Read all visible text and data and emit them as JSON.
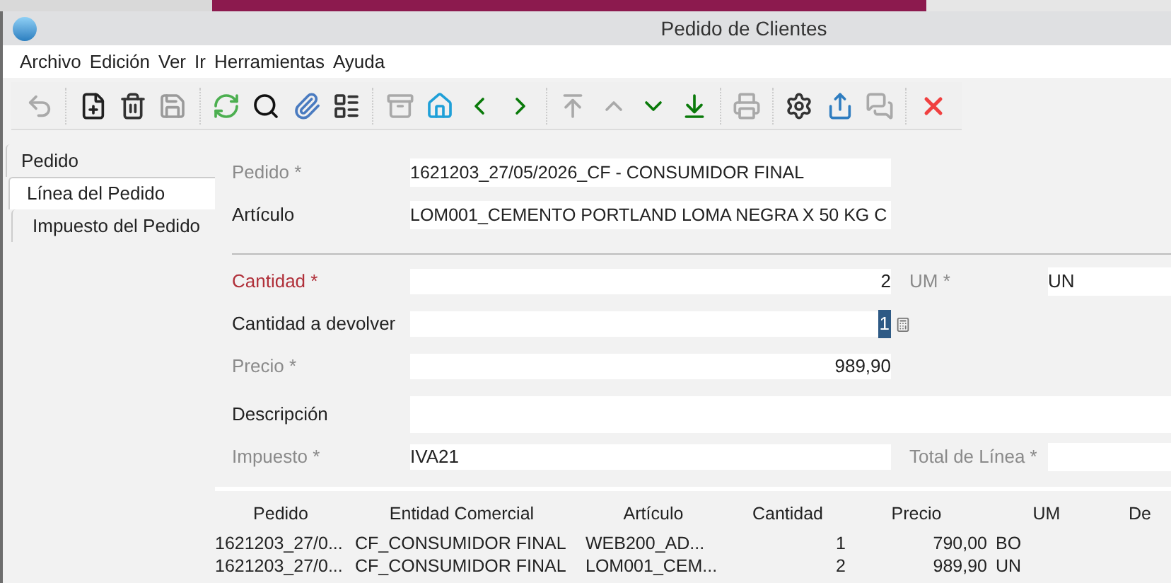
{
  "window": {
    "title": "Pedido de Clientes"
  },
  "menu": [
    {
      "label": "Archivo"
    },
    {
      "label": "Edición"
    },
    {
      "label": "Ver"
    },
    {
      "label": "Ir"
    },
    {
      "label": "Herramientas"
    },
    {
      "label": "Ayuda"
    }
  ],
  "toolbar": [
    {
      "kind": "undo",
      "disabled": true
    },
    {
      "kind": "sep"
    },
    {
      "kind": "new",
      "disabled": false
    },
    {
      "kind": "delete",
      "disabled": false
    },
    {
      "kind": "save",
      "disabled": true
    },
    {
      "kind": "sep"
    },
    {
      "kind": "refresh",
      "disabled": false
    },
    {
      "kind": "find",
      "disabled": false
    },
    {
      "kind": "attach",
      "disabled": false
    },
    {
      "kind": "grid",
      "disabled": false
    },
    {
      "kind": "sep"
    },
    {
      "kind": "archive",
      "disabled": true
    },
    {
      "kind": "home",
      "disabled": false
    },
    {
      "kind": "prev",
      "disabled": false
    },
    {
      "kind": "next",
      "disabled": false
    },
    {
      "kind": "sep"
    },
    {
      "kind": "first",
      "disabled": true
    },
    {
      "kind": "up",
      "disabled": true
    },
    {
      "kind": "down",
      "disabled": false
    },
    {
      "kind": "last",
      "disabled": false
    },
    {
      "kind": "sep"
    },
    {
      "kind": "print",
      "disabled": true
    },
    {
      "kind": "sep"
    },
    {
      "kind": "process",
      "disabled": false
    },
    {
      "kind": "export",
      "disabled": false
    },
    {
      "kind": "chat",
      "disabled": true
    },
    {
      "kind": "sep"
    },
    {
      "kind": "close",
      "disabled": false
    }
  ],
  "tabs": [
    {
      "label": "Pedido",
      "selected": false,
      "children": [
        {
          "label": "Línea del Pedido",
          "selected": true,
          "children": [
            {
              "label": "Impuesto del Pedido",
              "selected": false
            }
          ]
        }
      ]
    }
  ],
  "form": {
    "header_fields": [
      {
        "label": "Pedido *",
        "disabled": true,
        "value": "1621203_27/05/2026_CF - CONSUMIDOR FINAL"
      },
      {
        "label": "Artículo",
        "disabled": false,
        "value": "LOM001_CEMENTO PORTLAND LOMA NEGRA X 50 KG C"
      }
    ],
    "rows": [
      {
        "kind": "pair",
        "label": "Cantidad *",
        "disabled": false,
        "error": true,
        "value": "2",
        "numeric": true,
        "side_label": "UM *",
        "side_disabled": true,
        "side_value": "UN"
      },
      {
        "kind": "calc",
        "label": "Cantidad a devolver",
        "disabled": false,
        "error": false,
        "value": "1",
        "numeric": true,
        "selected": true
      },
      {
        "kind": "single",
        "label": "Precio *",
        "disabled": true,
        "error": false,
        "value": "989,90",
        "numeric": true
      },
      {
        "kind": "wide",
        "label": "Descripción",
        "disabled": false,
        "error": false
      },
      {
        "kind": "pair",
        "label": "Impuesto *",
        "disabled": true,
        "error": false,
        "value": "IVA21",
        "numeric": false,
        "side_label": "Total de Línea *",
        "side_disabled": true
      }
    ]
  },
  "table": {
    "columns": [
      "Pedido",
      "Entidad Comercial",
      "Artículo",
      "Cantidad",
      "Precio",
      "UM",
      "De"
    ],
    "rows": [
      [
        "1621203_27/0...",
        "CF_CONSUMIDOR FINAL",
        "WEB200_AD...",
        "1",
        "790,00",
        "BO"
      ],
      [
        "1621203_27/0...",
        "CF_CONSUMIDOR FINAL",
        "LOM001_CEM...",
        "2",
        "989,90",
        "UN"
      ]
    ]
  }
}
